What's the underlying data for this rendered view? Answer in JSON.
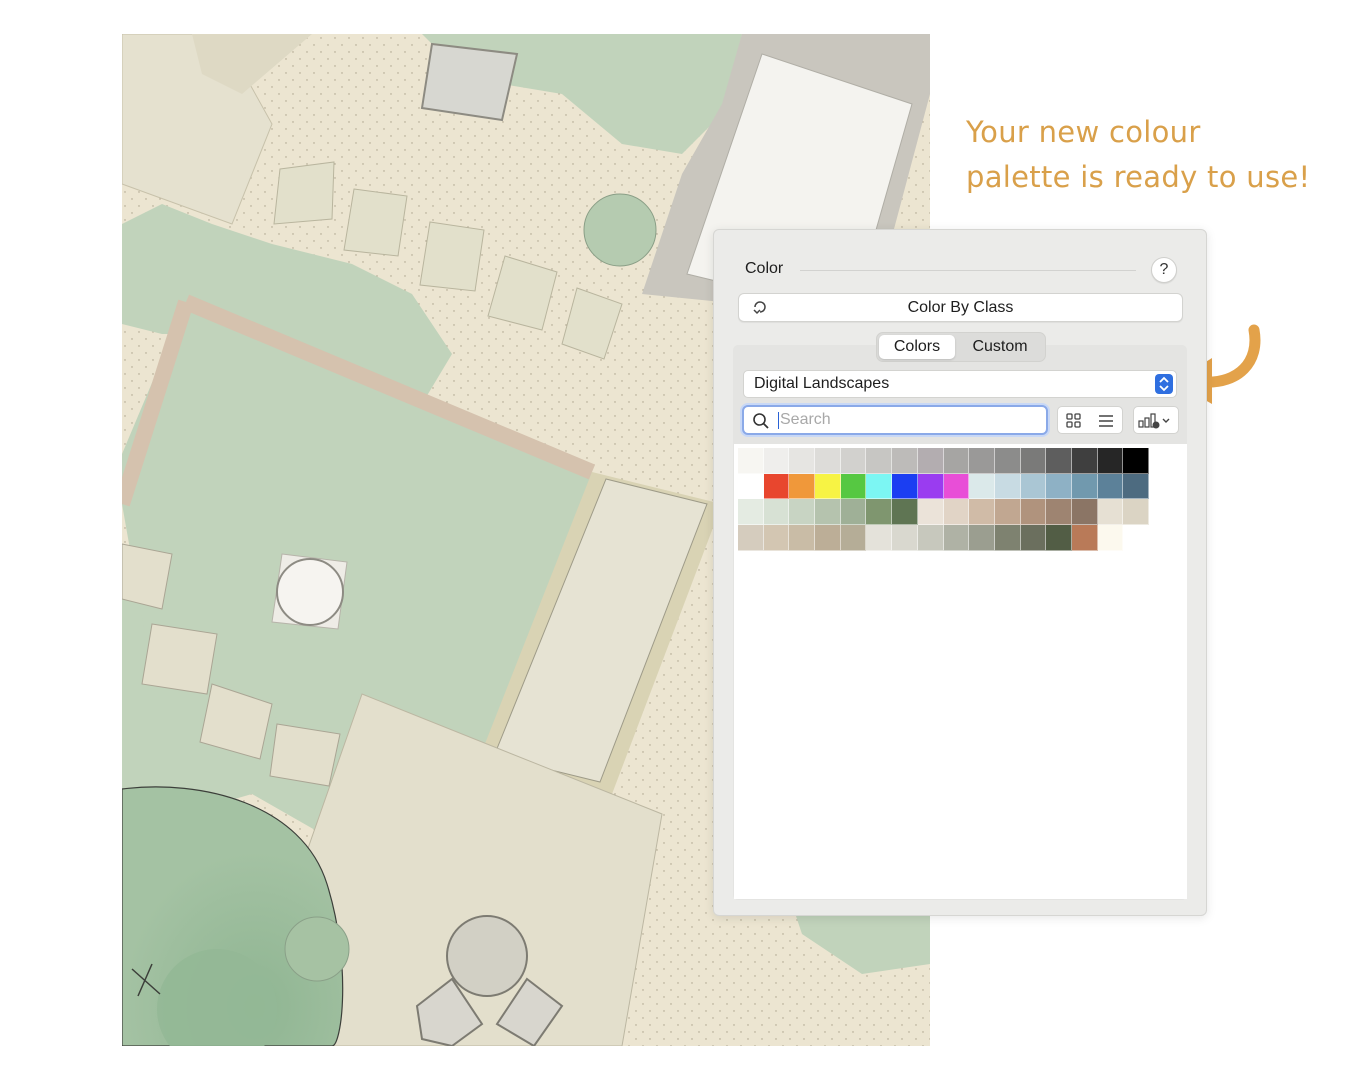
{
  "annotation": {
    "line1": "Your new colour",
    "line2": "palette is ready to use!",
    "accent_color": "#d9a04a"
  },
  "panel": {
    "title": "Color",
    "help_label": "?",
    "class_button_label": "Color By Class",
    "class_button_icon": "refresh-loop-icon",
    "tabs": [
      {
        "label": "Colors",
        "active": true
      },
      {
        "label": "Custom",
        "active": false
      }
    ],
    "palette_select": "Digital Landscapes",
    "search_placeholder": "Search",
    "view_icons": [
      "grid-view-icon",
      "list-view-icon",
      "sort-options-icon"
    ],
    "swatches": [
      "#f7f6f2",
      "#efeeec",
      "#e6e5e2",
      "#dddcd9",
      "#d2d1ce",
      "#c7c6c3",
      "#bdbbb9",
      "#b3adb0",
      "#a6a5a3",
      "#9a9998",
      "#8c8c8b",
      "#7a7a79",
      "#5e5e5e",
      "#3f3f3f",
      "#262626",
      "#000000",
      "#ffffff",
      "#e8462e",
      "#f0983a",
      "#f7f344",
      "#56c842",
      "#7cf6f3",
      "#1b3ef2",
      "#9a3cf0",
      "#e84ed7",
      "#dbe9ea",
      "#c8dbe3",
      "#aac6d4",
      "#8eb1c5",
      "#7199ae",
      "#5c8199",
      "#4d6b80",
      "#e4ebe2",
      "#d7e1d4",
      "#c8d4c3",
      "#b5c3ae",
      "#9fb097",
      "#7f966f",
      "#5f7553",
      "#ebe3d9",
      "#e1d4c6",
      "#d0bba7",
      "#c1a791",
      "#b0937d",
      "#9e8471",
      "#8b7565",
      "#e6e0d3",
      "#dbd4c4",
      "#d5ccbe",
      "#d3c6b2",
      "#c9bca6",
      "#bcae97",
      "#b5ad97",
      "#e4e2da",
      "#d9d8cf",
      "#c7c8bd",
      "#afb2a5",
      "#9b9e90",
      "#7e8270",
      "#6b6f5e",
      "#525d45",
      "#b97a58",
      "#fcf9ee"
    ]
  }
}
